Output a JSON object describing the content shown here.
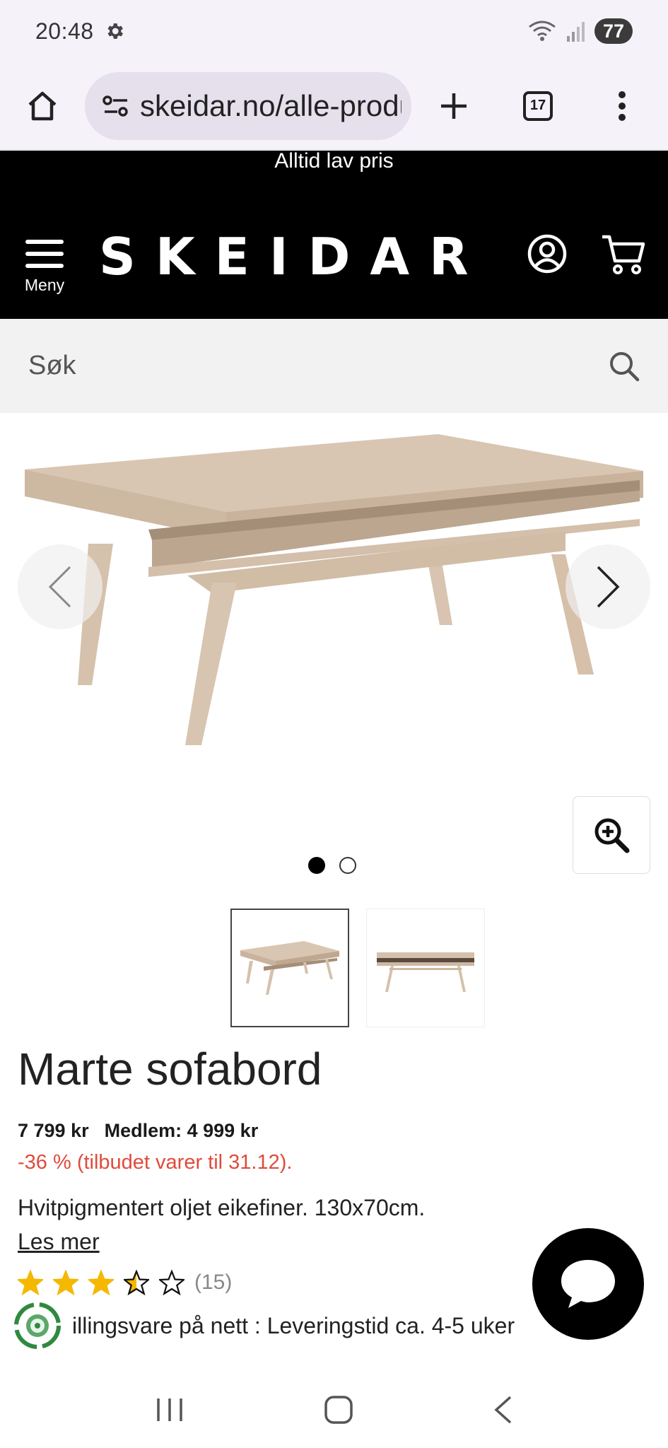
{
  "status_bar": {
    "time": "20:48",
    "battery": "77"
  },
  "browser": {
    "url": "skeidar.no/alle-produkter",
    "tab_count": "17"
  },
  "site": {
    "promo": "Alltid lav pris",
    "logo": "SKEIDAR",
    "menu_label": "Meny",
    "search_placeholder": "Søk"
  },
  "gallery": {
    "image_count": 2,
    "active_index": 0
  },
  "product": {
    "title": "Marte sofabord",
    "price": "7 799 kr",
    "member_price": "Medlem: 4 999 kr",
    "discount_text": "-36 % (tilbudet varer til 31.12).",
    "description": "Hvitpigmentert oljet eikefiner. 130x70cm.",
    "read_more": "Les mer",
    "rating": 3.5,
    "review_count": "(15)",
    "delivery": "illingsvare på nett : Leveringstid ca. 4-5 uker"
  },
  "colors": {
    "header_bg": "#000000",
    "discount_red": "#e04b3c",
    "star_yellow": "#f5b800",
    "browser_bg": "#f6f2fa"
  },
  "icons": [
    "settings-icon",
    "wifi-icon",
    "signal-icon",
    "home-icon",
    "site-info-icon",
    "plus-icon",
    "tabs-icon",
    "more-icon",
    "hamburger-icon",
    "account-icon",
    "cart-icon",
    "search-icon",
    "chevron-left-icon",
    "chevron-right-icon",
    "zoom-in-icon",
    "chat-icon",
    "recent-apps-icon",
    "home-nav-icon",
    "back-icon"
  ]
}
